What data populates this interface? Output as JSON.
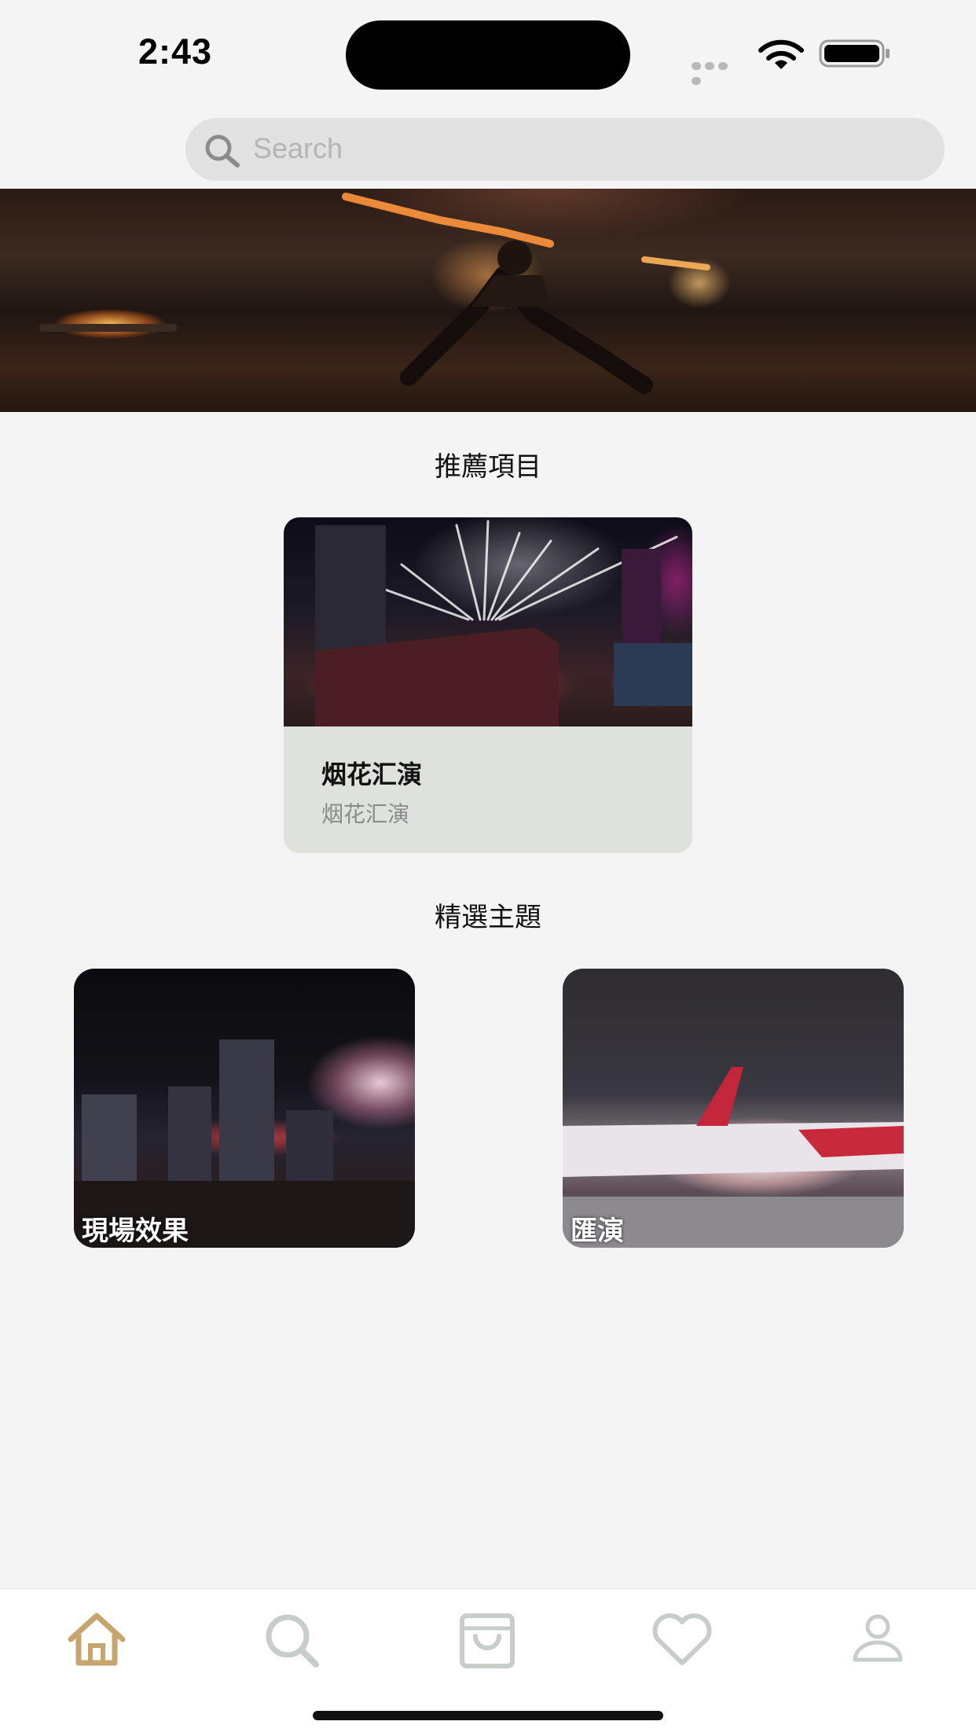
{
  "status_bar": {
    "time": "2:43",
    "icons": [
      "cellular-dots-icon",
      "wifi-icon",
      "battery-icon"
    ]
  },
  "search": {
    "placeholder": "Search",
    "icon": "search-icon"
  },
  "hero": {
    "image": "fire-performer-banner"
  },
  "recommended": {
    "heading": "推薦項目",
    "card": {
      "title": "烟花汇演",
      "subtitle": "烟花汇演",
      "image": "fireworks-stage-photo"
    }
  },
  "themes": {
    "heading": "精選主題",
    "items": [
      {
        "label": "現場效果",
        "image": "city-fireworks-crowd-photo"
      },
      {
        "label": "匯演",
        "image": "aircraft-sparks-photo"
      }
    ]
  },
  "tab_bar": {
    "items": [
      {
        "name": "home",
        "icon": "home-icon",
        "active": true
      },
      {
        "name": "search",
        "icon": "search-icon",
        "active": false
      },
      {
        "name": "shop",
        "icon": "shopping-bag-icon",
        "active": false
      },
      {
        "name": "favorites",
        "icon": "heart-icon",
        "active": false
      },
      {
        "name": "profile",
        "icon": "user-icon",
        "active": false
      }
    ]
  },
  "colors": {
    "background": "#f4f4f4",
    "search_field": "#e1e1e1",
    "card_info": "#dfe2dc",
    "tab_active": "#c8a46e",
    "tab_inactive": "#c7cdc9"
  }
}
